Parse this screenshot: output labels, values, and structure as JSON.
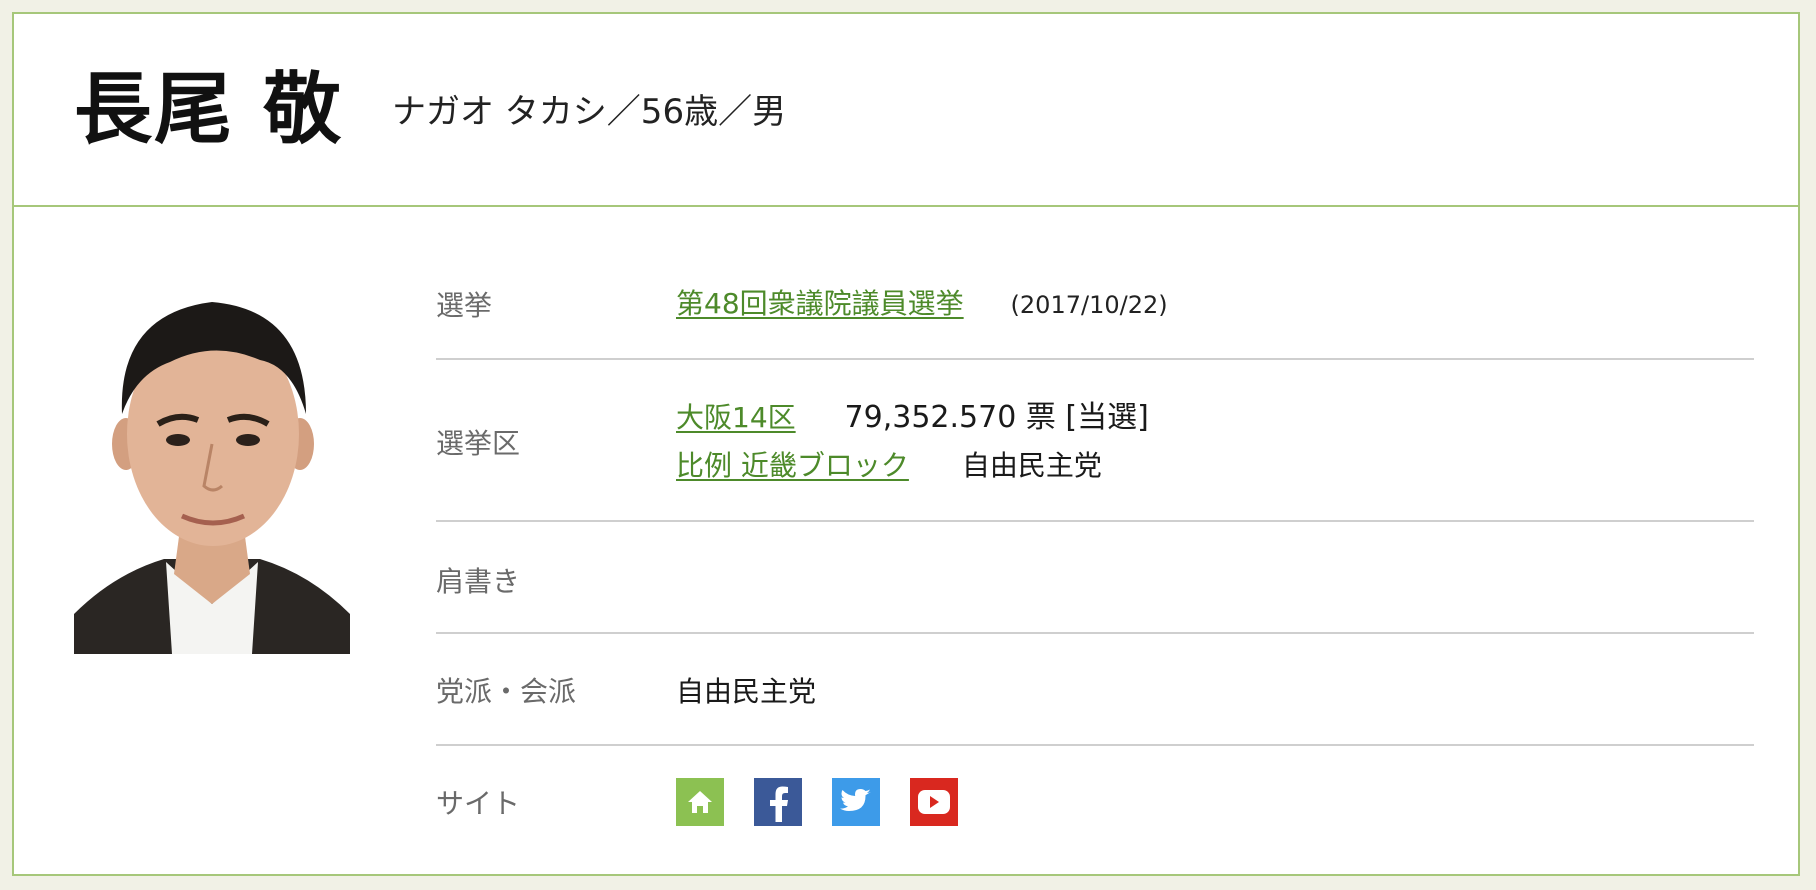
{
  "header": {
    "name": "長尾 敬",
    "subtitle": "ナガオ タカシ／56歳／男"
  },
  "rows": {
    "election": {
      "label": "選挙",
      "link": "第48回衆議院議員選挙",
      "date": "(2017/10/22)"
    },
    "district": {
      "label": "選挙区",
      "district_link": "大阪14区",
      "votes": "79,352.570 票 [当選]",
      "pr_link": "比例 近畿ブロック",
      "pr_party": "自由民主党"
    },
    "title": {
      "label": "肩書き",
      "value": ""
    },
    "party": {
      "label": "党派・会派",
      "value": "自由民主党"
    },
    "site": {
      "label": "サイト",
      "icons": [
        "home-icon",
        "facebook-icon",
        "twitter-icon",
        "youtube-icon"
      ]
    }
  },
  "colors": {
    "accent_border": "#a6c77a",
    "link": "#4d8a2a",
    "home": "#8cc152",
    "facebook": "#3b5998",
    "twitter": "#3d9be9",
    "youtube": "#d9281f"
  }
}
